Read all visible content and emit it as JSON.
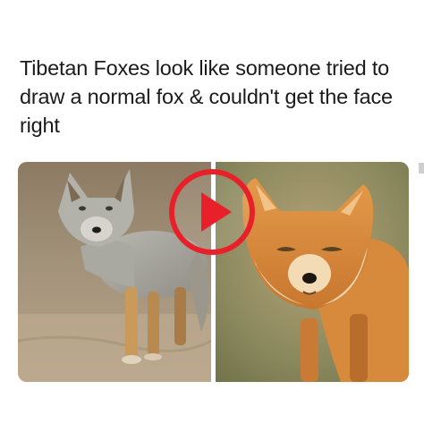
{
  "post": {
    "caption": "Tibetan Foxes look like someone tried to draw a normal fox & couldn't get the face right"
  },
  "media": {
    "left_photo_icon": "grey-fox-photo",
    "right_photo_icon": "tibetan-fox-photo",
    "play_icon": "play-icon",
    "play_color": "#e8202a"
  }
}
